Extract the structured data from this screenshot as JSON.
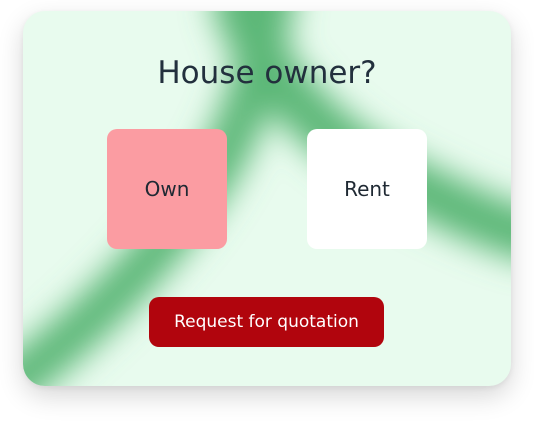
{
  "quote_card": {
    "title": "House owner?",
    "options": [
      {
        "label": "Own",
        "selected": true
      },
      {
        "label": "Rent",
        "selected": false
      }
    ],
    "cta_label": "Request for quotation"
  },
  "colors": {
    "card_background": "#e8fbee",
    "accent_green": "#5bb777",
    "selected_option": "#fb9ca2",
    "unselected_option": "#ffffff",
    "cta_background": "#b1050d",
    "title_text": "#22303d"
  }
}
